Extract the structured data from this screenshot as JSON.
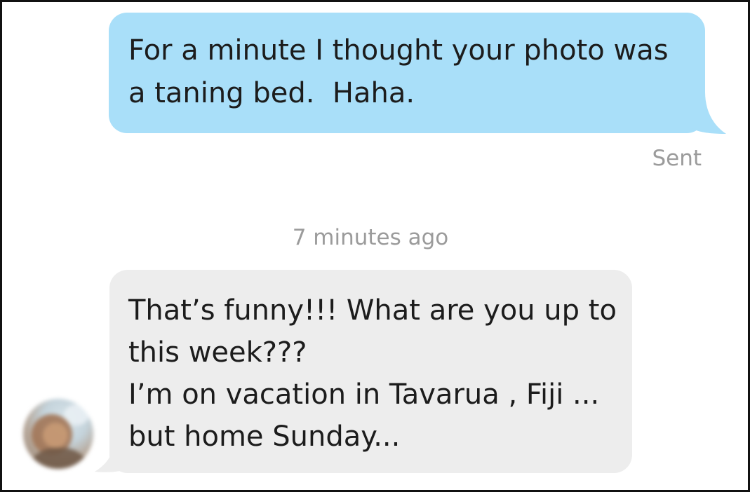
{
  "conversation": {
    "outgoing": {
      "lines": [
        "For a minute I thought your photo was",
        "a taning bed.  Haha."
      ],
      "status": "Sent"
    },
    "timestamp": "7 minutes ago",
    "incoming": {
      "lines": [
        "That’s funny!!! What are you up to",
        "this week???",
        "I’m on vacation in Tavarua , Fiji ...",
        "but home Sunday..."
      ]
    }
  },
  "colors": {
    "outgoing_bubble": "#a9dff9",
    "incoming_bubble": "#ededed",
    "meta_text": "#9b9b9b",
    "frame_border": "#111111"
  },
  "icons": {
    "avatar": "blurred-profile-photo"
  }
}
